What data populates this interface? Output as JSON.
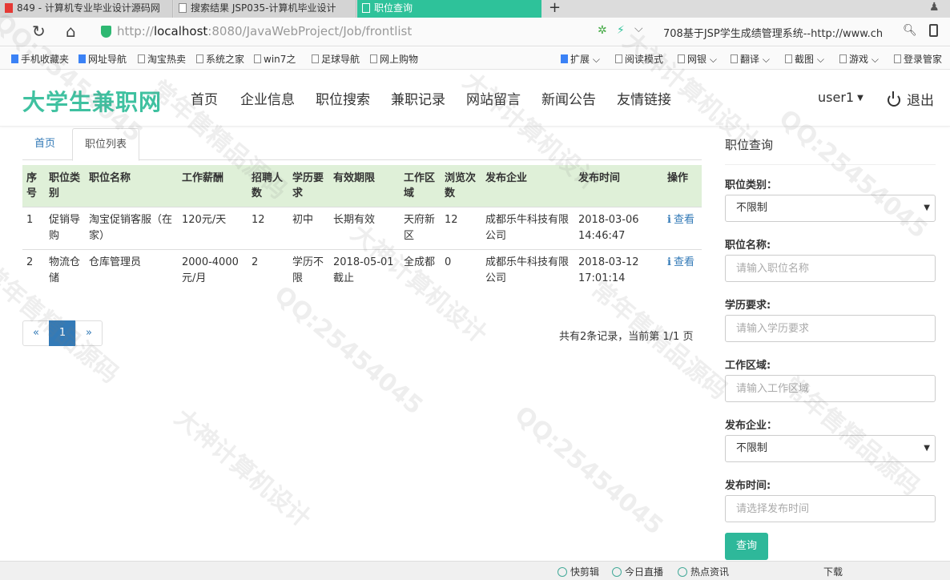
{
  "browser": {
    "tabs": [
      {
        "label": "849 - 计算机专业毕业设计源码网"
      },
      {
        "label": "搜索结果 JSP035-计算机毕业设计"
      },
      {
        "label": "职位查询"
      }
    ],
    "new_tab": "+",
    "url_prefix": "http://",
    "url_host": "localhost",
    "url_rest": ":8080/JavaWebProject/Job/frontlist",
    "search_text": "708基于JSP学生成绩管理系统--http://www.ch",
    "bookmarks": [
      "手机收藏夹",
      "网址导航",
      "淘宝热卖",
      "系统之家",
      "win7之",
      "足球导航",
      "网上购物"
    ],
    "toolbar": [
      "扩展",
      "阅读模式",
      "网银",
      "翻译",
      "截图",
      "游戏",
      "登录管家"
    ]
  },
  "site": {
    "brand": "大学生兼职网",
    "nav": [
      "首页",
      "企业信息",
      "职位搜索",
      "兼职记录",
      "网站留言",
      "新闻公告",
      "友情链接"
    ],
    "user": "user1",
    "logout": "退出"
  },
  "breadcrumb": {
    "home": "首页",
    "current": "职位列表"
  },
  "table": {
    "headers": [
      "序号",
      "职位类别",
      "职位名称",
      "工作薪酬",
      "招聘人数",
      "学历要求",
      "有效期限",
      "工作区域",
      "浏览次数",
      "发布企业",
      "发布时间",
      "操作"
    ],
    "rows": [
      [
        "1",
        "促销导购",
        "淘宝促销客服（在家）",
        "120元/天",
        "12",
        "初中",
        "长期有效",
        "天府新区",
        "12",
        "成都乐牛科技有限公司",
        "2018-03-06 14:46:47",
        "查看"
      ],
      [
        "2",
        "物流仓储",
        "仓库管理员",
        "2000-4000元/月",
        "2",
        "学历不限",
        "2018-05-01截止",
        "全成都",
        "0",
        "成都乐牛科技有限公司",
        "2018-03-12 17:01:14",
        "查看"
      ]
    ]
  },
  "pagination": {
    "prev": "«",
    "current": "1",
    "next": "»",
    "info": "共有2条记录，当前第 1/1 页"
  },
  "search_panel": {
    "title": "职位查询",
    "fields": [
      {
        "label": "职位类别：",
        "type": "select",
        "value": "不限制"
      },
      {
        "label": "职位名称:",
        "type": "input",
        "placeholder": "请输入职位名称"
      },
      {
        "label": "学历要求:",
        "type": "input",
        "placeholder": "请输入学历要求"
      },
      {
        "label": "工作区域:",
        "type": "input",
        "placeholder": "请输入工作区域"
      },
      {
        "label": "发布企业：",
        "type": "select",
        "value": "不限制"
      },
      {
        "label": "发布时间:",
        "type": "input",
        "placeholder": "请选择发布时间"
      }
    ],
    "submit": "查询"
  },
  "statusbar": [
    "快剪辑",
    "今日直播",
    "热点资讯",
    "下载"
  ],
  "watermarks": [
    "QQ:25454045",
    "大神计算机设计",
    "常年售精品源码"
  ],
  "colors": {
    "accent": "#3fc1a0",
    "active_tab": "#2ec29a",
    "table_header": "#dff0d8",
    "link": "#337ab7"
  }
}
